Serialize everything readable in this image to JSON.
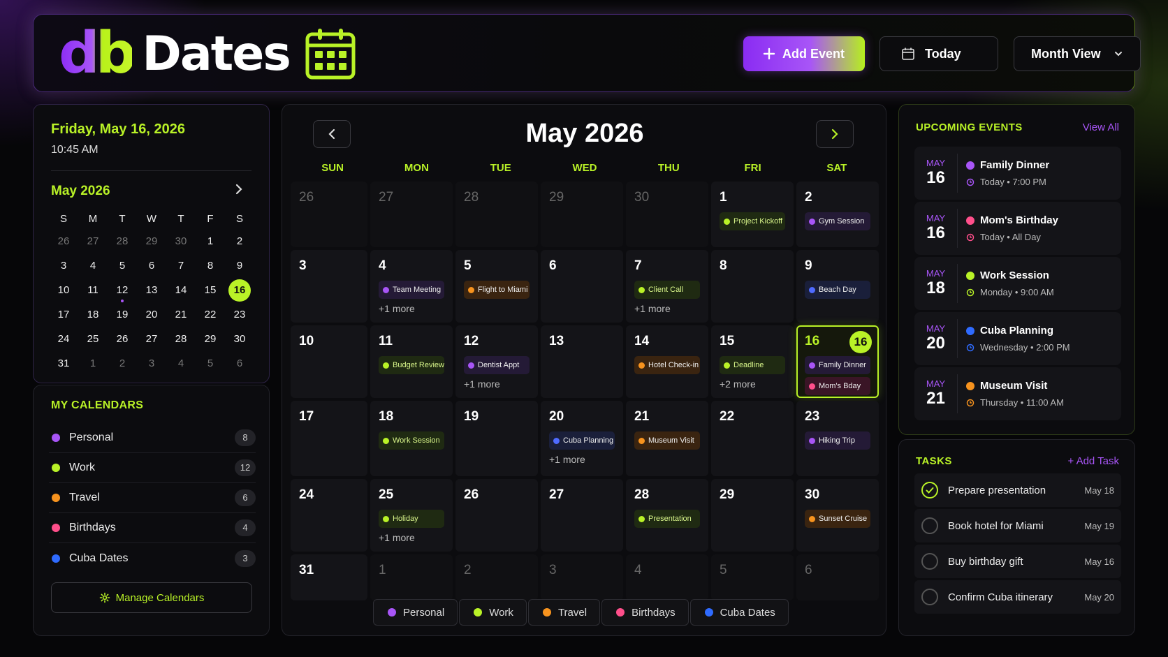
{
  "app": {
    "logo_mark": "db",
    "logo_text": "Dates"
  },
  "header": {
    "add_event": "Add Event",
    "today": "Today",
    "view": "Month View"
  },
  "sidebar": {
    "current_date": "Friday, May 16, 2026",
    "current_time": "10:45 AM",
    "mini_month": "May 2026",
    "weekday_letters": [
      "S",
      "M",
      "T",
      "W",
      "T",
      "F",
      "S"
    ],
    "mini_days": [
      {
        "d": "26",
        "muted": true
      },
      {
        "d": "27",
        "muted": true
      },
      {
        "d": "28",
        "muted": true
      },
      {
        "d": "29",
        "muted": true
      },
      {
        "d": "30",
        "muted": true
      },
      {
        "d": "1"
      },
      {
        "d": "2"
      },
      {
        "d": "3"
      },
      {
        "d": "4"
      },
      {
        "d": "5"
      },
      {
        "d": "6"
      },
      {
        "d": "7"
      },
      {
        "d": "8"
      },
      {
        "d": "9"
      },
      {
        "d": "10"
      },
      {
        "d": "11"
      },
      {
        "d": "12",
        "dot": true
      },
      {
        "d": "13"
      },
      {
        "d": "14"
      },
      {
        "d": "15"
      },
      {
        "d": "16",
        "selected": true
      },
      {
        "d": "17"
      },
      {
        "d": "18"
      },
      {
        "d": "19"
      },
      {
        "d": "20"
      },
      {
        "d": "21"
      },
      {
        "d": "22"
      },
      {
        "d": "23"
      },
      {
        "d": "24"
      },
      {
        "d": "25"
      },
      {
        "d": "26"
      },
      {
        "d": "27"
      },
      {
        "d": "28"
      },
      {
        "d": "29"
      },
      {
        "d": "30"
      },
      {
        "d": "31"
      },
      {
        "d": "1",
        "muted": true
      },
      {
        "d": "2",
        "muted": true
      },
      {
        "d": "3",
        "muted": true
      },
      {
        "d": "4",
        "muted": true
      },
      {
        "d": "5",
        "muted": true
      },
      {
        "d": "6",
        "muted": true
      }
    ],
    "calendars_title": "MY CALENDARS",
    "calendars": [
      {
        "name": "Personal",
        "count": "8",
        "color": "#a855f7"
      },
      {
        "name": "Work",
        "count": "12",
        "color": "#b9f227"
      },
      {
        "name": "Travel",
        "count": "6",
        "color": "#f7931e"
      },
      {
        "name": "Birthdays",
        "count": "4",
        "color": "#ff4f8b"
      },
      {
        "name": "Cuba Dates",
        "count": "3",
        "color": "#2f6bff"
      }
    ],
    "manage_label": "Manage Calendars"
  },
  "calendar": {
    "title": "May 2026",
    "weekdays": [
      "SUN",
      "MON",
      "TUE",
      "WED",
      "THU",
      "FRI",
      "SAT"
    ],
    "cells": [
      {
        "n": "26",
        "muted": true
      },
      {
        "n": "27",
        "muted": true
      },
      {
        "n": "28",
        "muted": true
      },
      {
        "n": "29",
        "muted": true
      },
      {
        "n": "30",
        "muted": true
      },
      {
        "n": "1",
        "events": [
          {
            "t": "Project Kickoff",
            "k": "w"
          }
        ]
      },
      {
        "n": "2",
        "events": [
          {
            "t": "Gym Session",
            "k": "p"
          }
        ]
      },
      {
        "n": "3"
      },
      {
        "n": "4",
        "events": [
          {
            "t": "Team Meeting",
            "k": "p"
          }
        ],
        "more": "+1 more"
      },
      {
        "n": "5",
        "events": [
          {
            "t": "Flight to Miami",
            "k": "t"
          }
        ]
      },
      {
        "n": "6"
      },
      {
        "n": "7",
        "events": [
          {
            "t": "Client Call",
            "k": "w"
          }
        ],
        "more": "+1 more"
      },
      {
        "n": "8"
      },
      {
        "n": "9",
        "events": [
          {
            "t": "Beach Day",
            "k": "c"
          }
        ]
      },
      {
        "n": "10"
      },
      {
        "n": "11",
        "events": [
          {
            "t": "Budget Review",
            "k": "w"
          }
        ]
      },
      {
        "n": "12",
        "events": [
          {
            "t": "Dentist Appt",
            "k": "p"
          }
        ],
        "more": "+1 more"
      },
      {
        "n": "13"
      },
      {
        "n": "14",
        "events": [
          {
            "t": "Hotel Check-in",
            "k": "t"
          }
        ]
      },
      {
        "n": "15",
        "events": [
          {
            "t": "Deadline",
            "k": "w"
          }
        ],
        "more": "+2 more"
      },
      {
        "n": "16",
        "today": true,
        "badge": "16",
        "events": [
          {
            "t": "Family Dinner",
            "k": "p"
          },
          {
            "t": "Mom's Bday",
            "k": "b"
          }
        ]
      },
      {
        "n": "17"
      },
      {
        "n": "18",
        "events": [
          {
            "t": "Work Session",
            "k": "w"
          }
        ]
      },
      {
        "n": "19"
      },
      {
        "n": "20",
        "events": [
          {
            "t": "Cuba Planning",
            "k": "c"
          }
        ],
        "more": "+1 more"
      },
      {
        "n": "21",
        "events": [
          {
            "t": "Museum Visit",
            "k": "t"
          }
        ]
      },
      {
        "n": "22"
      },
      {
        "n": "23",
        "events": [
          {
            "t": "Hiking Trip",
            "k": "p"
          }
        ]
      },
      {
        "n": "24"
      },
      {
        "n": "25",
        "events": [
          {
            "t": "Holiday",
            "k": "w"
          }
        ],
        "more": "+1 more"
      },
      {
        "n": "26"
      },
      {
        "n": "27"
      },
      {
        "n": "28",
        "events": [
          {
            "t": "Presentation",
            "k": "w"
          }
        ]
      },
      {
        "n": "29"
      },
      {
        "n": "30",
        "events": [
          {
            "t": "Sunset Cruise",
            "k": "t"
          }
        ]
      },
      {
        "n": "31"
      },
      {
        "n": "1",
        "muted": true
      },
      {
        "n": "2",
        "muted": true
      },
      {
        "n": "3",
        "muted": true
      },
      {
        "n": "4",
        "muted": true
      },
      {
        "n": "5",
        "muted": true
      },
      {
        "n": "6",
        "muted": true
      }
    ],
    "legend": [
      {
        "name": "Personal",
        "color": "#a855f7"
      },
      {
        "name": "Work",
        "color": "#b9f227"
      },
      {
        "name": "Travel",
        "color": "#f7931e"
      },
      {
        "name": "Birthdays",
        "color": "#ff4f8b"
      },
      {
        "name": "Cuba Dates",
        "color": "#2f6bff"
      }
    ]
  },
  "upcoming": {
    "title": "UPCOMING EVENTS",
    "view_all": "View All",
    "items": [
      {
        "mon": "MAY",
        "day": "16",
        "name": "Family Dinner",
        "when": "Today • 7:00 PM",
        "color": "#a855f7"
      },
      {
        "mon": "MAY",
        "day": "16",
        "name": "Mom's Birthday",
        "when": "Today • All Day",
        "color": "#ff4f8b"
      },
      {
        "mon": "MAY",
        "day": "18",
        "name": "Work Session",
        "when": "Monday • 9:00 AM",
        "color": "#b9f227"
      },
      {
        "mon": "MAY",
        "day": "20",
        "name": "Cuba Planning",
        "when": "Wednesday • 2:00 PM",
        "color": "#2f6bff"
      },
      {
        "mon": "MAY",
        "day": "21",
        "name": "Museum Visit",
        "when": "Thursday • 11:00 AM",
        "color": "#f7931e"
      }
    ]
  },
  "tasks": {
    "title": "TASKS",
    "add_label": "+ Add Task",
    "items": [
      {
        "name": "Prepare presentation",
        "date": "May 18",
        "done": true
      },
      {
        "name": "Book hotel for Miami",
        "date": "May 19",
        "done": false
      },
      {
        "name": "Buy birthday gift",
        "date": "May 16",
        "done": false
      },
      {
        "name": "Confirm Cuba itinerary",
        "date": "May 20",
        "done": false
      }
    ]
  }
}
